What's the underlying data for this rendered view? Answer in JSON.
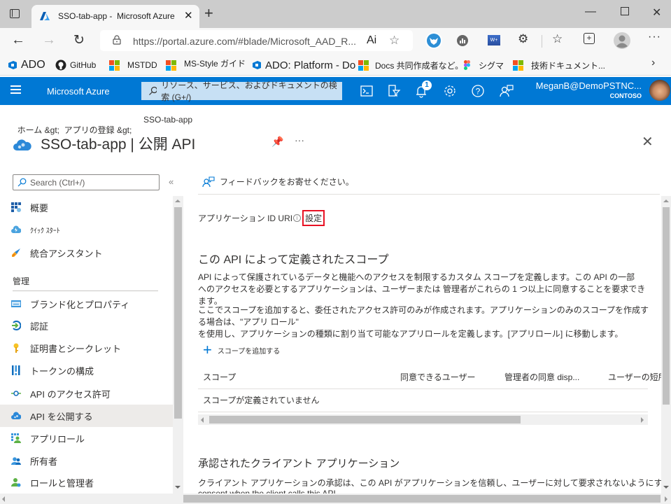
{
  "browser": {
    "tab_title": "SSO-tab-app -  Microsoft Azure",
    "url": "https://portal.azure.com/#blade/Microsoft_AAD_R...",
    "read_aloud_label": "Ai",
    "bookmarks": [
      {
        "label": "ADO",
        "icon": "azure-devops-icon"
      },
      {
        "label": "GitHub",
        "icon": "github-icon"
      },
      {
        "label": "MSTDD",
        "icon": "microsoft-logo-icon"
      },
      {
        "label": "MS-Style ガイド",
        "icon": "microsoft-logo-icon"
      },
      {
        "label": "ADO: Platform - Do",
        "icon": "azure-devops-icon"
      },
      {
        "label": "Docs 共同作成者など。",
        "icon": "microsoft-logo-icon"
      },
      {
        "label": "シグマ",
        "icon": "figma-icon"
      },
      {
        "label": "技術ドキュメント...",
        "icon": "microsoft-logo-icon"
      }
    ],
    "extension_label_w": "W+"
  },
  "azure_header": {
    "brand": "Microsoft Azure",
    "search_placeholder": "リソース、サービス、およびドキュメントの検索 (G+/)",
    "notification_count": "1",
    "user_name": "MeganB@DemoPSTNC...",
    "tenant": "CONTOSO"
  },
  "breadcrumb": {
    "home": "ホーム &gt;  アプリの登録 &gt;",
    "current": "SSO-tab-app"
  },
  "page": {
    "title": "SSO-tab-app | 公開 API",
    "more_label": "···"
  },
  "sidebar": {
    "search_placeholder": "Search (Ctrl+/)",
    "collapse_label": "«",
    "items": [
      {
        "label": "概要",
        "icon": "overview-icon"
      },
      {
        "label": "ｸｲｯｸ ｽﾀｰﾄ",
        "icon": "quickstart-icon"
      },
      {
        "label": "統合アシスタント",
        "icon": "rocket-icon"
      }
    ],
    "section_manage": "管理",
    "manage_items": [
      {
        "label": "ブランド化とプロパティ",
        "icon": "branding-icon"
      },
      {
        "label": "認証",
        "icon": "authentication-icon"
      },
      {
        "label": "証明書とシークレット",
        "icon": "key-icon"
      },
      {
        "label": "トークンの構成",
        "icon": "token-icon"
      },
      {
        "label": "API のアクセス許可",
        "icon": "api-permissions-icon"
      },
      {
        "label": "API を公開する",
        "icon": "expose-api-icon",
        "active": true
      },
      {
        "label": "アプリロール",
        "icon": "app-roles-icon"
      },
      {
        "label": "所有者",
        "icon": "owners-icon"
      },
      {
        "label": "ロールと管理者",
        "icon": "roles-admins-icon"
      }
    ]
  },
  "main": {
    "feedback_label": "フィードバックをお寄せください。",
    "app_id_uri_label": "アプリケーション ID URI",
    "set_label": "設定",
    "scopes_title": "この API によって定義されたスコープ",
    "scopes_desc_1a": "API によって保護されているデータと機能へのアクセスを制限するカスタム スコープを定義します。この API の一部",
    "scopes_desc_1b": "へのアクセスを必要とするアプリケーションは、ユーザーまたは 管理者がこれらの 1 つ以上に同意することを要求できます。",
    "scopes_desc_2a": "ここでスコープを追加すると、委任されたアクセス許可のみが作成されます。アプリケーションのみのスコープを作成する場合は、\"アプリ ロール\"",
    "scopes_desc_2b": "を使用し、アプリケーションの種類に割り当て可能なアプリロールを定義します。[アプリロール] に移動します。",
    "add_scope_label": "スコープを追加する",
    "table": {
      "columns": [
        "スコープ",
        "同意できるユーザー",
        "管理者の同意 disp...",
        "ユーザーの短所"
      ],
      "empty_message": "スコープが定義されていません"
    },
    "clients_title": "承認されたクライアント アプリケーション",
    "clients_desc": "クライアント アプリケーションの承認は、この API がアプリケーションを信頼し、ユーザーに対して要求されないようにすることを示します。",
    "clients_desc_cont": "consent when the client calls this API"
  },
  "colors": {
    "azure_blue": "#0078d4",
    "highlight_red": "#e81123",
    "active_nav_bg": "#edebe9"
  }
}
